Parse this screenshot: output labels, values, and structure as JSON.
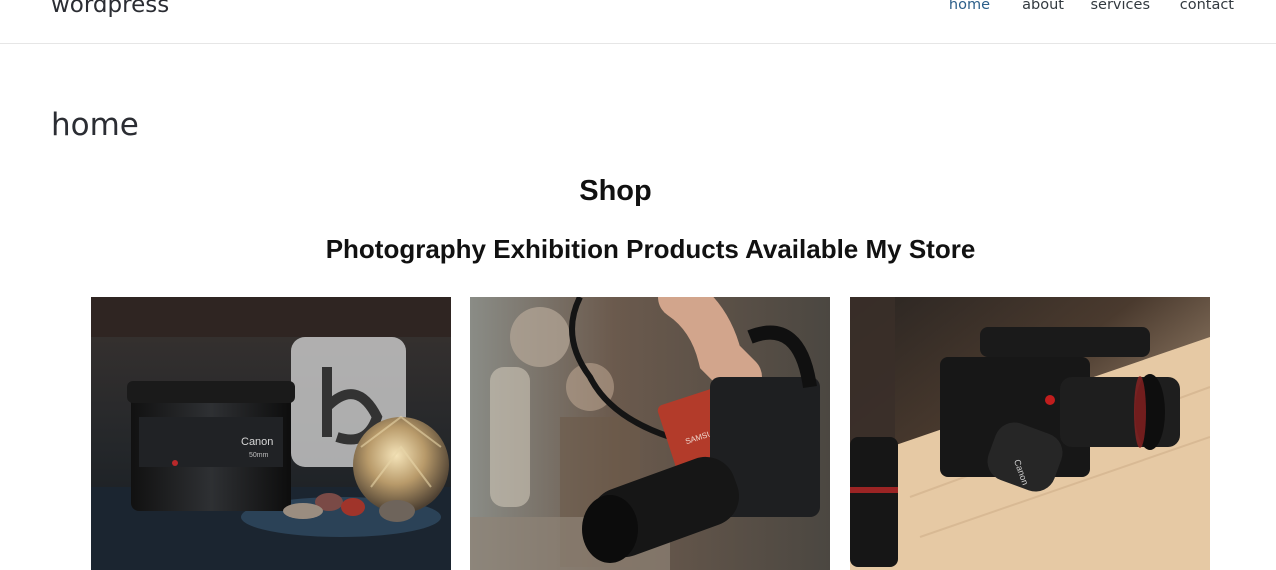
{
  "site": {
    "title": "wordpress"
  },
  "nav": {
    "items": [
      {
        "label": "home",
        "active": true
      },
      {
        "label": "about",
        "active": false
      },
      {
        "label": "services",
        "active": false
      },
      {
        "label": "contact",
        "active": false
      }
    ]
  },
  "page": {
    "title": "home",
    "shop_heading": "Shop",
    "sub_heading": "Photography Exhibition Products Available My Store"
  },
  "products": [
    {
      "image": "camera-lens-on-table-photo",
      "brand_text": "Canon",
      "lens_text": "50mm"
    },
    {
      "image": "hand-holding-cinema-camera-photo",
      "brand_text": "SAMSUNG"
    },
    {
      "image": "cinema-camera-on-wooden-table-photo",
      "brand_text": "Canon"
    }
  ],
  "colors": {
    "nav_active": "#2c5f8a",
    "text": "#2b2d33",
    "header_border": "#e6e6e6"
  }
}
